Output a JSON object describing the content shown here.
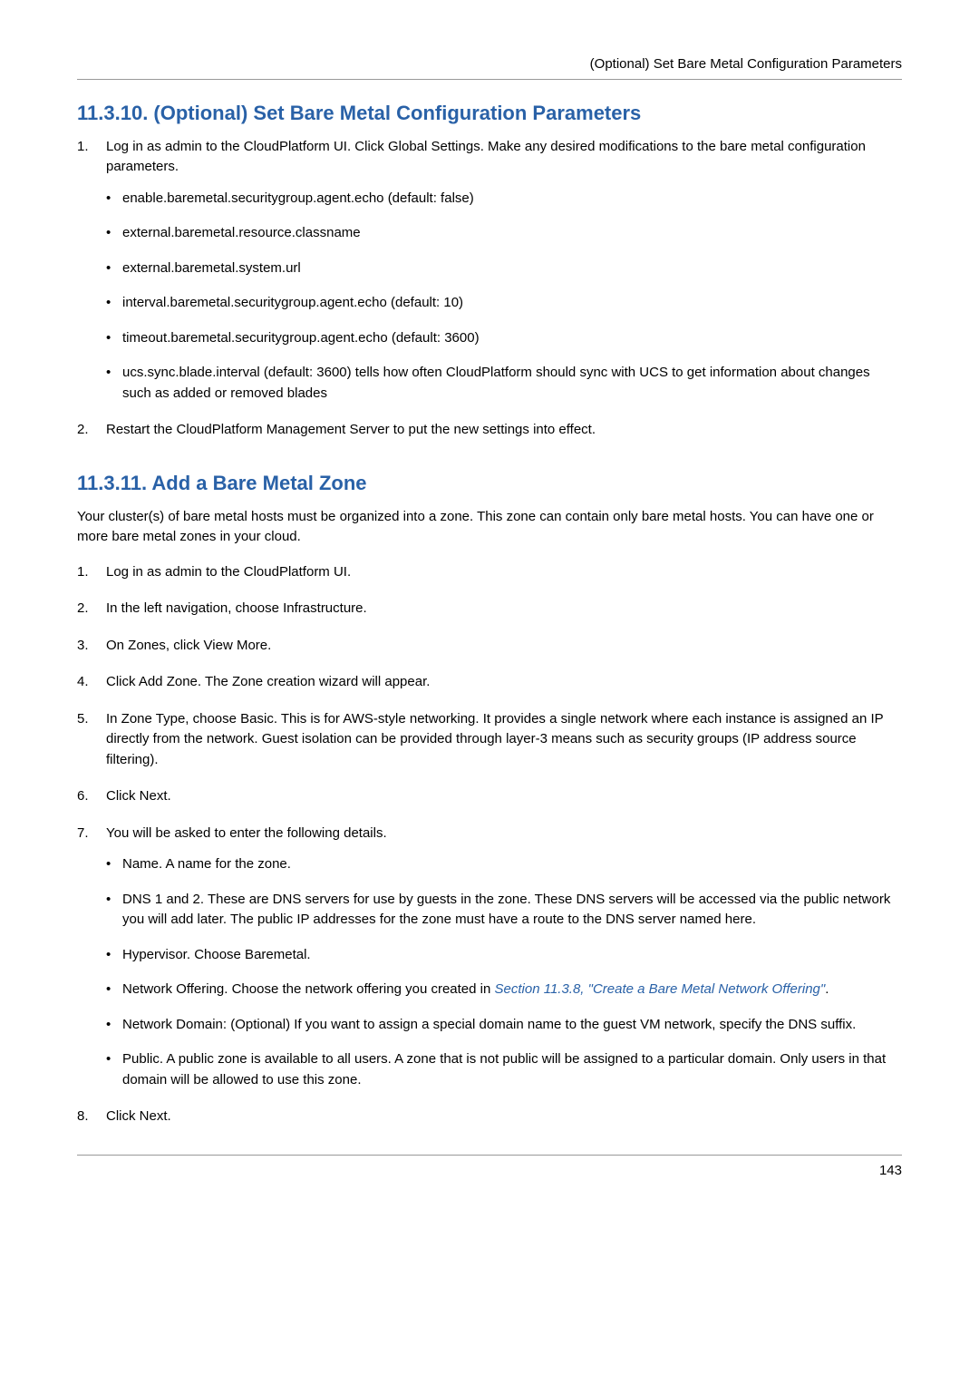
{
  "header": {
    "right_text": "(Optional) Set Bare Metal Configuration Parameters"
  },
  "section1": {
    "heading": "11.3.10. (Optional) Set Bare Metal Configuration Parameters",
    "step1": {
      "text": "Log in as admin to the CloudPlatform UI. Click Global Settings. Make any desired modifications to the bare metal configuration parameters.",
      "bullets": {
        "b1": "enable.baremetal.securitygroup.agent.echo (default: false)",
        "b2": "external.baremetal.resource.classname",
        "b3": "external.baremetal.system.url",
        "b4": "interval.baremetal.securitygroup.agent.echo (default: 10)",
        "b5": "timeout.baremetal.securitygroup.agent.echo (default: 3600)",
        "b6": "ucs.sync.blade.interval (default: 3600) tells how often CloudPlatform should sync with UCS to get information about changes such as added or removed blades"
      }
    },
    "step2": {
      "text": "Restart the CloudPlatform Management Server to put the new settings into effect."
    }
  },
  "section2": {
    "heading": "11.3.11. Add a Bare Metal Zone",
    "intro": "Your cluster(s) of bare metal hosts must be organized into a zone. This zone can contain only bare metal hosts. You can have one or more bare metal zones in your cloud.",
    "step1": "Log in as admin to the CloudPlatform UI.",
    "step2": "In the left navigation, choose Infrastructure.",
    "step3": "On Zones, click View More.",
    "step4": "Click Add Zone. The Zone creation wizard will appear.",
    "step5": "In Zone Type, choose Basic. This is for AWS-style networking. It provides a single network where each instance is assigned an IP directly from the network. Guest isolation can be provided through layer-3 means such as security groups (IP address source filtering).",
    "step6": "Click Next.",
    "step7": {
      "text": "You will be asked to enter the following details.",
      "bullets": {
        "b1": "Name. A name for the zone.",
        "b2": "DNS 1 and 2. These are DNS servers for use by guests in the zone. These DNS servers will be accessed via the public network you will add later. The public IP addresses for the zone must have a route to the DNS server named here.",
        "b3": "Hypervisor. Choose Baremetal.",
        "b4_prefix": "Network Offering. Choose the network offering you created in ",
        "b4_link": "Section 11.3.8, \"Create a Bare Metal Network Offering\"",
        "b4_suffix": ".",
        "b5": "Network Domain: (Optional) If you want to assign a special domain name to the guest VM network, specify the DNS suffix.",
        "b6": "Public. A public zone is available to all users. A zone that is not public will be assigned to a particular domain. Only users in that domain will be allowed to use this zone."
      }
    },
    "step8": "Click Next."
  },
  "footer": {
    "page_number": "143"
  }
}
